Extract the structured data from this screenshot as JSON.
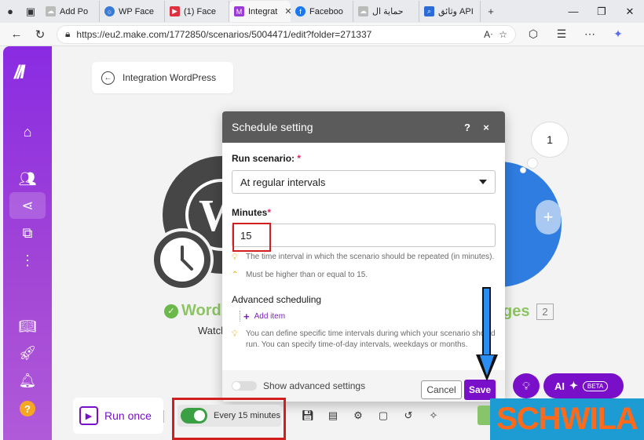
{
  "browser": {
    "tabs": [
      {
        "label": "Add Po",
        "icon": "cloud-icon",
        "active": false
      },
      {
        "label": "WP Face",
        "icon": "circle-logo-icon",
        "active": false
      },
      {
        "label": "(1) Face",
        "icon": "youtube-icon",
        "active": false
      },
      {
        "label": "Integrat",
        "icon": "make-logo-icon",
        "active": true
      },
      {
        "label": "Faceboo",
        "icon": "facebook-icon",
        "active": false
      },
      {
        "label": "حماية ال",
        "icon": "cloud-icon",
        "active": false
      },
      {
        "label": "وثائق API",
        "icon": "search-icon",
        "active": false
      }
    ],
    "url": "https://eu2.make.com/1772850/scenarios/5004471/edit?folder=271337"
  },
  "scenario": {
    "breadcrumb": "Integration WordPress",
    "module_left_title": "Word",
    "module_left_subtitle": "Watch",
    "module_right_title": "ges",
    "module_right_badge": "2",
    "count_bubble": "1"
  },
  "dialog": {
    "title": "Schedule setting",
    "help": "?",
    "close": "×",
    "run_label": "Run scenario:",
    "required_mark": "*",
    "run_value": "At regular intervals",
    "minutes_label": "Minutes",
    "minutes_value": "15",
    "hint_interval": "The time interval in which the scenario should be repeated (in minutes).",
    "hint_min": "Must be higher than or equal to 15.",
    "advanced_label": "Advanced scheduling",
    "add_item": "Add item",
    "hint_specific": "You can define specific time intervals during which your scenario should run. You can specify time-of-day intervals, weekdays or months.",
    "show_advanced": "Show advanced settings",
    "cancel": "Cancel",
    "save": "Save"
  },
  "toolbar": {
    "run_once": "Run once",
    "schedule_text": "Every 15 minutes",
    "ai_label": "AI",
    "beta": "BETA"
  },
  "watermark": "SCHWILA",
  "colors": {
    "brand_purple": "#7a0fc9",
    "toggle_green": "#3b9f43",
    "annotation_red": "#d11f1f",
    "arrow_blue": "#2a8df2"
  }
}
